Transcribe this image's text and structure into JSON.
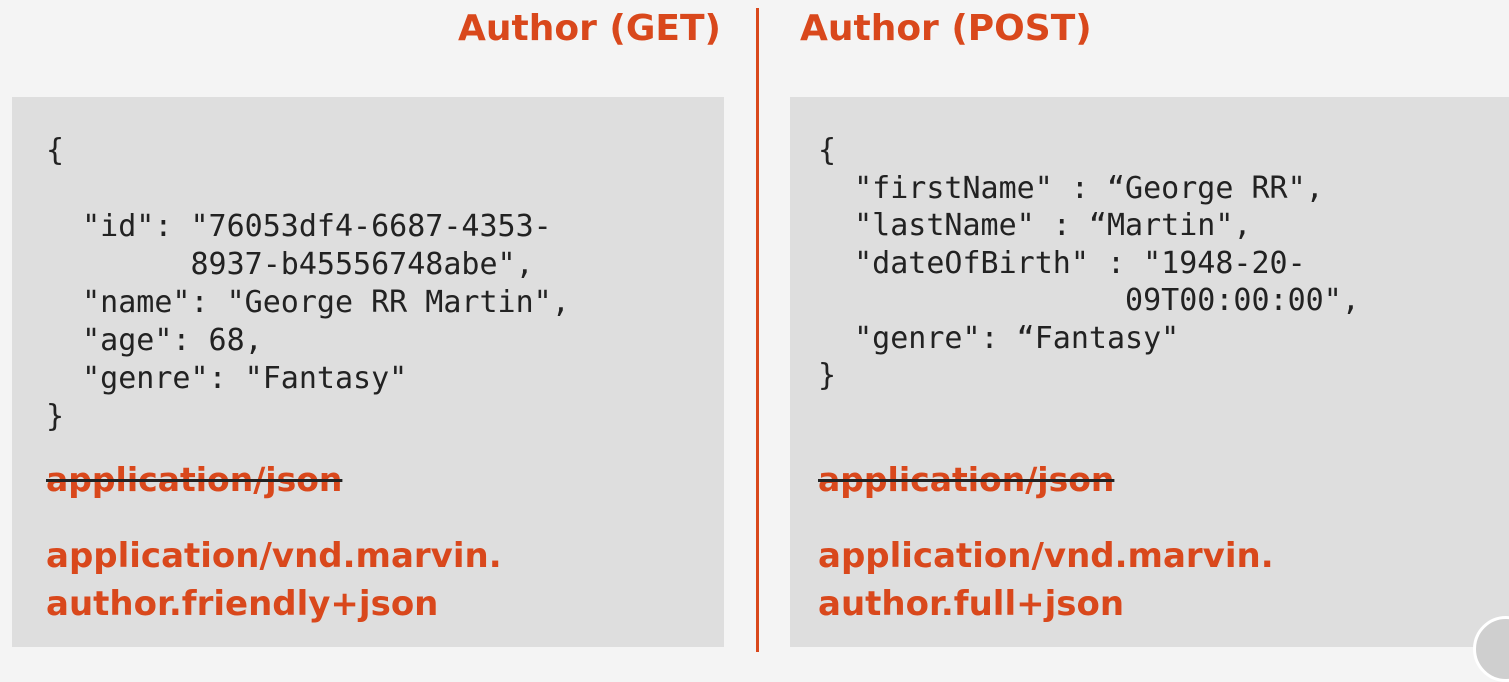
{
  "left": {
    "title": "Author (GET)",
    "code": "{\n\n  \"id\": \"76053df4-6687-4353-\n        8937-b45556748abe\",\n  \"name\": \"George RR Martin\",\n  \"age\": 68,\n  \"genre\": \"Fantasy\"\n}",
    "old_media_type": "application/json",
    "new_media_type": "application/vnd.marvin.\nauthor.friendly+json"
  },
  "right": {
    "title": "Author (POST)",
    "code": "{\n  \"firstName\" : “George RR\",\n  \"lastName\" : “Martin\",\n  \"dateOfBirth\" : \"1948-20-\n                 09T00:00:00\",\n  \"genre\": “Fantasy\"\n}",
    "old_media_type": "application/json",
    "new_media_type": "application/vnd.marvin.\nauthor.full+json"
  },
  "colors": {
    "accent": "#d9481c",
    "panel": "#dedede",
    "background": "#f4f4f4",
    "text": "#222222"
  }
}
